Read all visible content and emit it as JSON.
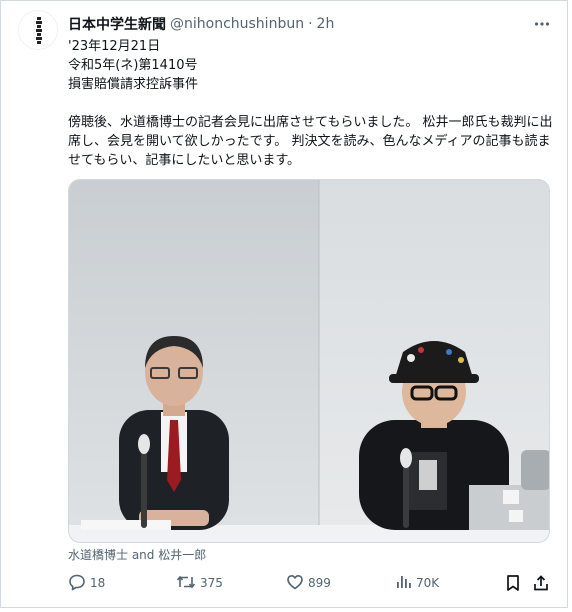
{
  "post": {
    "author_name": "日本中学生新聞",
    "handle": "@nihonchushinbun",
    "separator": "·",
    "time": "2h",
    "body": "'23年12月21日\n令和5年(ネ)第1410号\n損害賠償請求控訴事件\n\n傍聴後、水道橋博士の記者会見に出席させてもらいました。 松井一郎氏も裁判に出席し、会見を開いて欲しかったです。 判決文を読み、色んなメディアの記事も読ませてもらい、記事にしたいと思います。",
    "media_caption": "水道橋博士 and 松井一郎"
  },
  "actions": {
    "replies": "18",
    "reposts": "375",
    "likes": "899",
    "views": "70K"
  },
  "icons": {
    "more": "more-icon",
    "reply": "reply-icon",
    "repost": "repost-icon",
    "like": "heart-icon",
    "views": "views-icon",
    "bookmark": "bookmark-icon",
    "share": "share-icon"
  },
  "colors": {
    "text": "#0f1419",
    "muted": "#536471",
    "border": "#cfd9de"
  }
}
